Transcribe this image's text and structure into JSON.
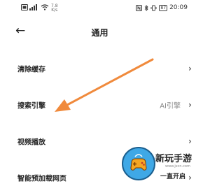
{
  "status_bar": {
    "net_speed": "7.8",
    "net_unit": "K/s",
    "battery": "87",
    "time": "20:09"
  },
  "header": {
    "back_icon": "arrow-left-icon",
    "title": "通用"
  },
  "settings": [
    {
      "label": "清除缓存",
      "value": ""
    },
    {
      "label": "搜索引擎",
      "value": "AI引擎"
    },
    {
      "label": "视频播放",
      "value": ""
    },
    {
      "label": "智能预加载网页",
      "value": ""
    }
  ],
  "annotation": {
    "arrow_color": "#f08a3c"
  },
  "watermark": {
    "name": "新玩手游",
    "url": "www.jxcn.com",
    "slogan": "一直开启"
  }
}
